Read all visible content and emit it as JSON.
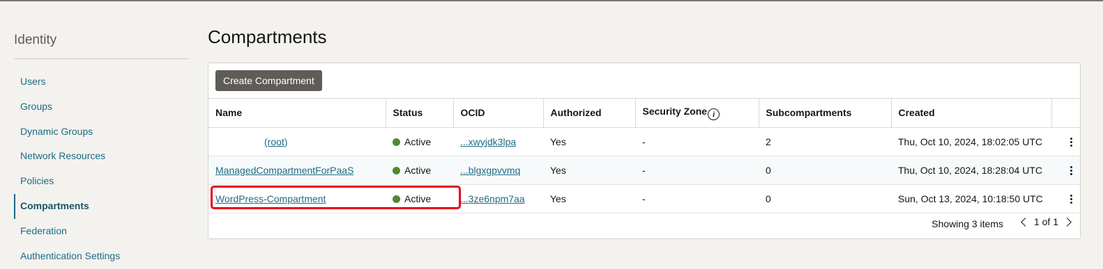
{
  "sidebar": {
    "title": "Identity",
    "items": [
      {
        "label": "Users"
      },
      {
        "label": "Groups"
      },
      {
        "label": "Dynamic Groups"
      },
      {
        "label": "Network Resources"
      },
      {
        "label": "Policies"
      },
      {
        "label": "Compartments",
        "active": true
      },
      {
        "label": "Federation"
      },
      {
        "label": "Authentication Settings"
      }
    ]
  },
  "main": {
    "title": "Compartments",
    "create_button": "Create Compartment",
    "columns": [
      "Name",
      "Status",
      "OCID",
      "Authorized",
      "Security Zone",
      "Subcompartments",
      "Created"
    ],
    "rows": [
      {
        "name": "(root)",
        "status": "Active",
        "ocid": "...xwyjdk3lpa",
        "authorized": "Yes",
        "security_zone": "-",
        "subcompartments": "2",
        "created": "Thu, Oct 10, 2024, 18:02:05 UTC"
      },
      {
        "name": "ManagedCompartmentForPaaS",
        "status": "Active",
        "ocid": "...blgxgpvvmq",
        "authorized": "Yes",
        "security_zone": "-",
        "subcompartments": "0",
        "created": "Thu, Oct 10, 2024, 18:28:04 UTC"
      },
      {
        "name": "WordPress-Compartment",
        "status": "Active",
        "ocid": "...3ze6npm7aa",
        "authorized": "Yes",
        "security_zone": "-",
        "subcompartments": "0",
        "created": "Sun, Oct 13, 2024, 10:18:50 UTC"
      }
    ],
    "footer": {
      "showing": "Showing 3 items",
      "page": "1 of 1"
    }
  },
  "colors": {
    "accent": "#1e6b84",
    "status_active": "#4f8a2f",
    "highlight": "#e8000b",
    "button": "#5f5c58"
  },
  "icons": {
    "info": "info-circle-icon",
    "actions": "kebab-menu-icon",
    "prev": "chevron-left-icon",
    "next": "chevron-right-icon"
  }
}
